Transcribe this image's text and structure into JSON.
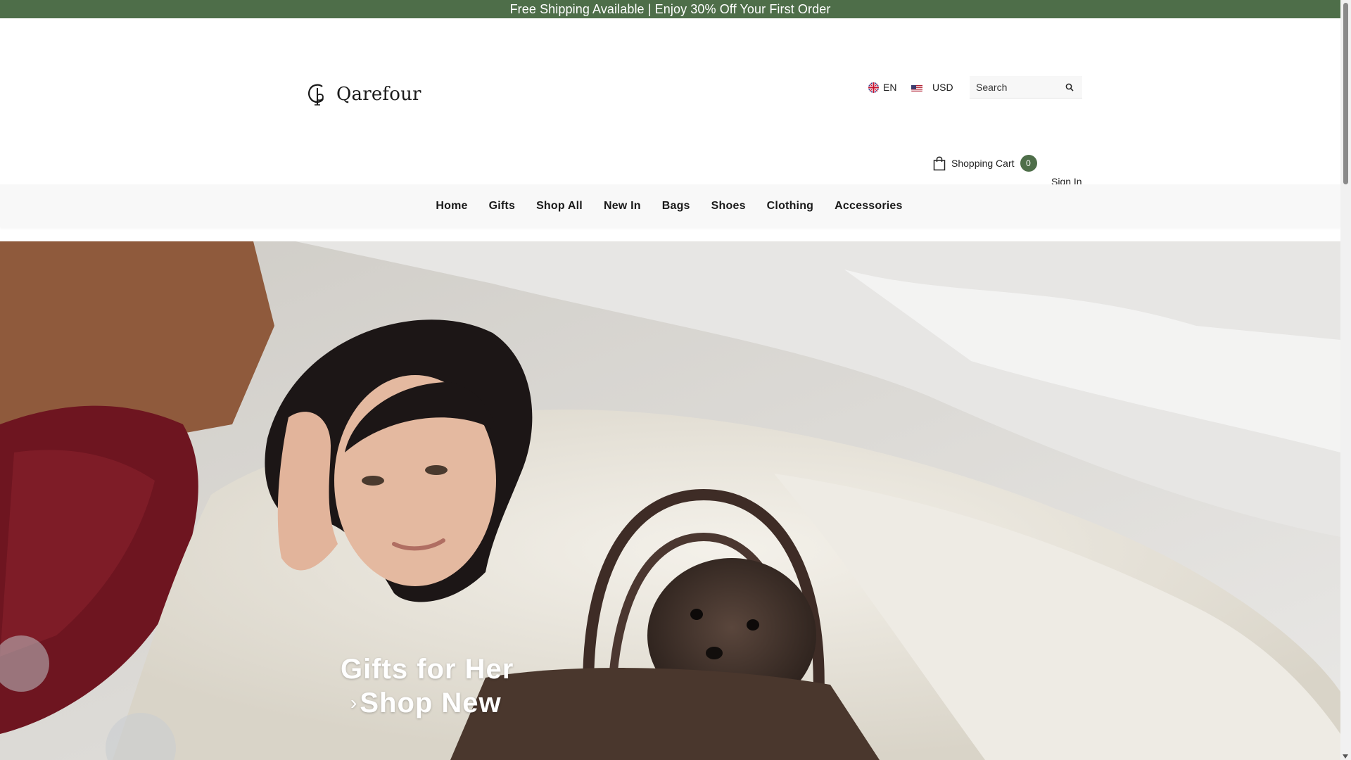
{
  "promo": {
    "text": "Free Shipping Available | Enjoy 30% Off Your First Order"
  },
  "header": {
    "logo_text": "Qarefour",
    "language": {
      "code": "EN",
      "icon": "uk-flag-icon"
    },
    "currency": {
      "code": "USD",
      "icon": "us-flag-icon"
    },
    "search": {
      "placeholder": "Search",
      "value": "",
      "icon": "search-icon"
    },
    "cart": {
      "label": "Shopping Cart",
      "count": "0",
      "icon": "shopping-bag-icon"
    },
    "signin_label": "Sign In"
  },
  "nav": {
    "items": [
      {
        "label": "Home"
      },
      {
        "label": "Gifts"
      },
      {
        "label": "Shop All"
      },
      {
        "label": "New In"
      },
      {
        "label": "Bags"
      },
      {
        "label": "Shoes"
      },
      {
        "label": "Clothing"
      },
      {
        "label": "Accessories"
      }
    ]
  },
  "hero": {
    "title": "Gifts for Her",
    "cta_label": "Shop New",
    "cta_arrow": "›"
  },
  "colors": {
    "accent": "#4e6e49",
    "nav_bg": "#f8f8f8"
  }
}
